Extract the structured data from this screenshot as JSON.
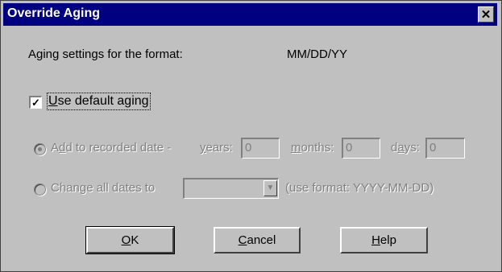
{
  "window": {
    "title": "Override Aging",
    "close_glyph": "✕"
  },
  "aging": {
    "label": "Aging settings for the format:",
    "format": "MM/DD/YY"
  },
  "use_default": {
    "label_pre": "",
    "label_ul": "U",
    "label_post": "se default aging",
    "checked": true
  },
  "add_option": {
    "label_pre": "A",
    "label_ul": "d",
    "label_post": "d to recorded date -",
    "selected": true,
    "years_pre": "",
    "years_ul": "y",
    "years_post": "ears:",
    "years_value": "0",
    "months_pre": "",
    "months_ul": "m",
    "months_post": "onths:",
    "months_value": "0",
    "days_pre": "d",
    "days_ul": "a",
    "days_post": "ys:",
    "days_value": "0"
  },
  "change_option": {
    "label_pre": "Chan",
    "label_ul": "g",
    "label_post": "e all dates to",
    "selected": false,
    "date_value": "",
    "hint": "(use format: YYYY-MM-DD)"
  },
  "buttons": {
    "ok_ul": "O",
    "ok_post": "K",
    "cancel_ul": "C",
    "cancel_post": "ancel",
    "help_ul": "H",
    "help_post": "elp"
  }
}
